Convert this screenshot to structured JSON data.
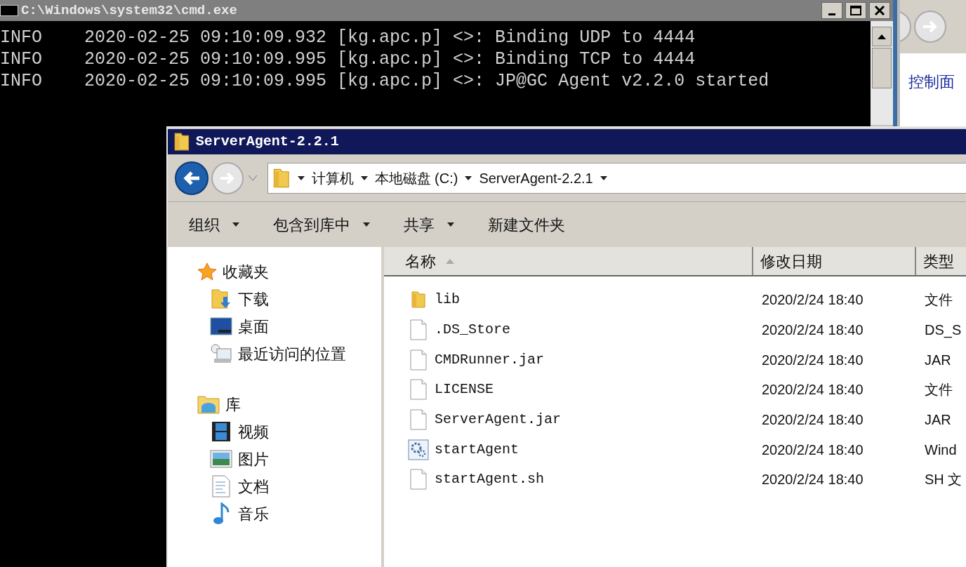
{
  "console": {
    "title": "C:\\Windows\\system32\\cmd.exe",
    "lines": [
      "INFO    2020-02-25 09:10:09.932 [kg.apc.p] <>: Binding UDP to 4444",
      "INFO    2020-02-25 09:10:09.995 [kg.apc.p] <>: Binding TCP to 4444",
      "INFO    2020-02-25 09:10:09.995 [kg.apc.p] <>: JP@GC Agent v2.2.0 started"
    ]
  },
  "back_window": {
    "link": "控制面"
  },
  "explorer": {
    "title": "ServerAgent-2.2.1",
    "breadcrumb": [
      "计算机",
      "本地磁盘 (C:)",
      "ServerAgent-2.2.1"
    ],
    "toolbar": [
      {
        "label": "组织",
        "dropdown": true
      },
      {
        "label": "包含到库中",
        "dropdown": true
      },
      {
        "label": "共享",
        "dropdown": true
      },
      {
        "label": "新建文件夹",
        "dropdown": false
      }
    ],
    "sidebar": [
      {
        "label": "收藏夹",
        "kind": "star",
        "children": [
          {
            "label": "下载",
            "kind": "download"
          },
          {
            "label": "桌面",
            "kind": "desktop"
          },
          {
            "label": "最近访问的位置",
            "kind": "recent"
          }
        ]
      },
      {
        "label": "库",
        "kind": "library",
        "children": [
          {
            "label": "视频",
            "kind": "video"
          },
          {
            "label": "图片",
            "kind": "picture"
          },
          {
            "label": "文档",
            "kind": "document"
          },
          {
            "label": "音乐",
            "kind": "music"
          }
        ]
      }
    ],
    "columns": [
      {
        "label": "名称",
        "sorted": true
      },
      {
        "label": "修改日期",
        "sorted": false
      },
      {
        "label": "类型",
        "sorted": false
      }
    ],
    "rows": [
      {
        "name": "lib",
        "date": "2020/2/24 18:40",
        "type": "文件",
        "kind": "folder"
      },
      {
        "name": ".DS_Store",
        "date": "2020/2/24 18:40",
        "type": "DS_S",
        "kind": "file"
      },
      {
        "name": "CMDRunner.jar",
        "date": "2020/2/24 18:40",
        "type": "JAR",
        "kind": "file"
      },
      {
        "name": "LICENSE",
        "date": "2020/2/24 18:40",
        "type": "文件",
        "kind": "file"
      },
      {
        "name": "ServerAgent.jar",
        "date": "2020/2/24 18:40",
        "type": "JAR",
        "kind": "file"
      },
      {
        "name": "startAgent",
        "date": "2020/2/24 18:40",
        "type": "Wind",
        "kind": "script"
      },
      {
        "name": "startAgent.sh",
        "date": "2020/2/24 18:40",
        "type": "SH 文",
        "kind": "file"
      }
    ]
  }
}
